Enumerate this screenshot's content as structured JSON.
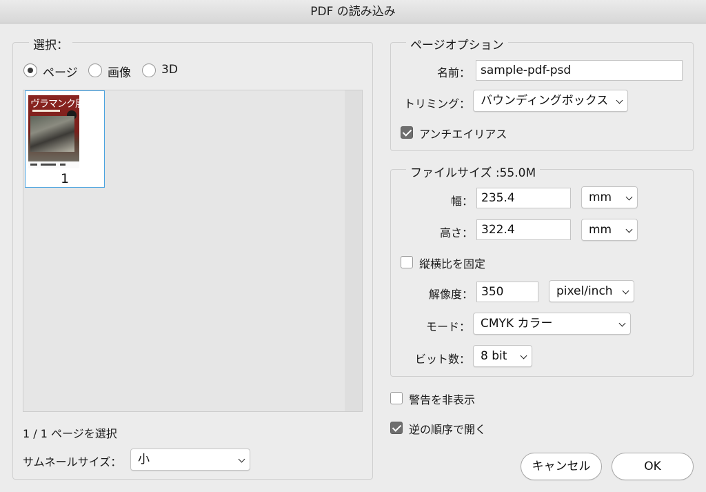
{
  "window": {
    "title": "PDF の読み込み"
  },
  "select_group": {
    "legend": "選択：",
    "radios": [
      {
        "label": "ページ",
        "checked": true
      },
      {
        "label": "画像",
        "checked": false
      },
      {
        "label": "3D",
        "checked": false
      }
    ],
    "thumbnail": {
      "cover_title": "ヴラマンク展",
      "page_number": "1"
    },
    "status": "1 / 1 ページを選択",
    "thumb_size_label": "サムネールサイズ：",
    "thumb_size_value": "小"
  },
  "page_options": {
    "legend": "ページオプション",
    "name_label": "名前：",
    "name_value": "sample-pdf-psd",
    "crop_label": "トリミング：",
    "crop_value": "バウンディングボックス",
    "antialias_label": "アンチエイリアス",
    "antialias_checked": true
  },
  "image_size": {
    "legend": "ファイルサイズ :55.0M",
    "width_label": "幅：",
    "width_value": "235.4",
    "width_unit": "mm",
    "height_label": "高さ：",
    "height_value": "322.4",
    "height_unit": "mm",
    "constrain_label": "縦横比を固定",
    "constrain_checked": false,
    "resolution_label": "解像度：",
    "resolution_value": "350",
    "resolution_unit": "pixel/inch",
    "mode_label": "モード：",
    "mode_value": "CMYK カラー",
    "bitdepth_label": "ビット数：",
    "bitdepth_value": "8 bit"
  },
  "options": {
    "suppress_warnings_label": "警告を非表示",
    "suppress_warnings_checked": false,
    "reverse_order_label": "逆の順序で開く",
    "reverse_order_checked": true
  },
  "buttons": {
    "cancel": "キャンセル",
    "ok": "OK"
  },
  "colors": {
    "accent": "#4aa3e0",
    "window_bg": "#ececec",
    "check_on": "#6e6e6e"
  }
}
